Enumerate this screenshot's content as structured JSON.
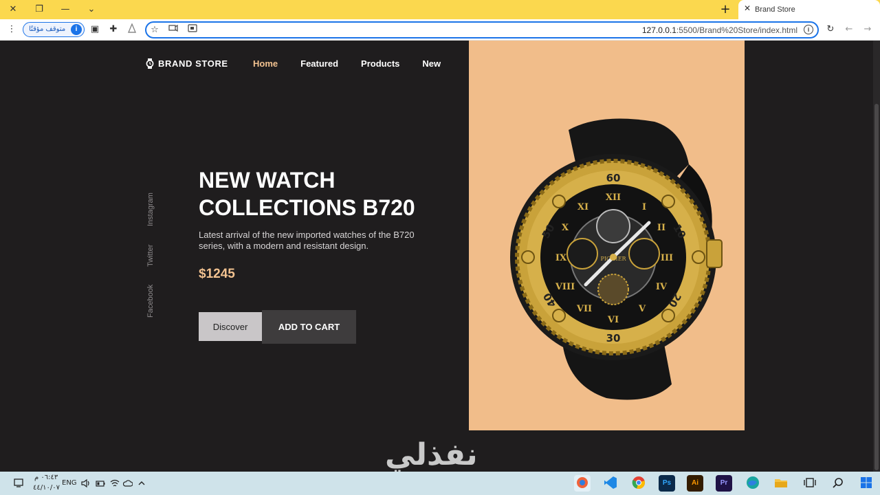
{
  "browser": {
    "tab_title": "Brand Store",
    "status_pill": "متوقف مؤقتًا",
    "url_host": "127.0.0.1",
    "url_path": ":5500/Brand%20Store/index.html",
    "icons": {
      "close": "✕",
      "restore": "❐",
      "minimize": "—",
      "dropdown": "⌄",
      "new_tab": "+",
      "tab_close": "✕",
      "menu": "⋮",
      "sidebar": "▣",
      "extensions": "✚",
      "star": "☆",
      "refresh": "↻",
      "back": "←",
      "forward": "→",
      "info": "i"
    }
  },
  "site": {
    "brand": "BRAND STORE",
    "nav": [
      "Home",
      "Featured",
      "Products",
      "New"
    ],
    "active_nav": "Home",
    "socials": [
      "Instagram",
      "Twitter",
      "Facebook"
    ],
    "hero": {
      "title_line1": "NEW WATCH",
      "title_line2": "COLLECTIONS B720",
      "description": "Latest arrival of the new imported watches of the B720 series, with a modern and resistant design.",
      "price": "$1245",
      "discover_label": "Discover",
      "cart_label": "ADD TO CART"
    },
    "colors": {
      "bg": "#1f1d1e",
      "accent": "#f2c290",
      "panel": "#f1bd8a"
    }
  },
  "watermark": "نفذلي",
  "taskbar": {
    "time": "٠٦:٤٣ م",
    "date": "٤٤/١٠/٠٧",
    "lang": "ENG",
    "apps": [
      "Ps",
      "Ai",
      "Pr"
    ]
  }
}
